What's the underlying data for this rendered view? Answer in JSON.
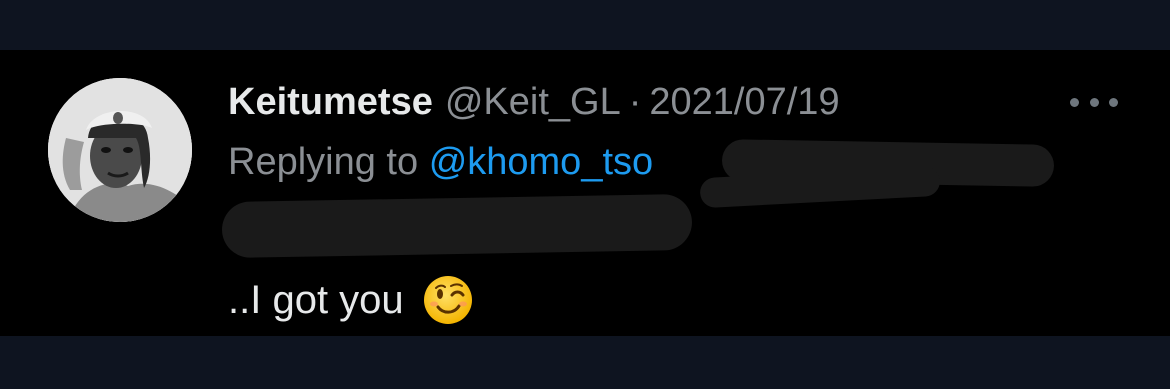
{
  "tweet": {
    "display_name": "Keitumetse",
    "handle": "@Keit_GL",
    "separator": "·",
    "date": "2021/07/19",
    "reply_label": "Replying to",
    "reply_mention": "@khomo_tso",
    "text": "..I got you",
    "emoji": "winking-face-emoji"
  },
  "icons": {
    "more": "more-options-icon",
    "avatar": "profile-photo"
  },
  "colors": {
    "background": "#000000",
    "name": "#e7e9ea",
    "muted": "#8b8f94",
    "link": "#1d9bf0"
  }
}
